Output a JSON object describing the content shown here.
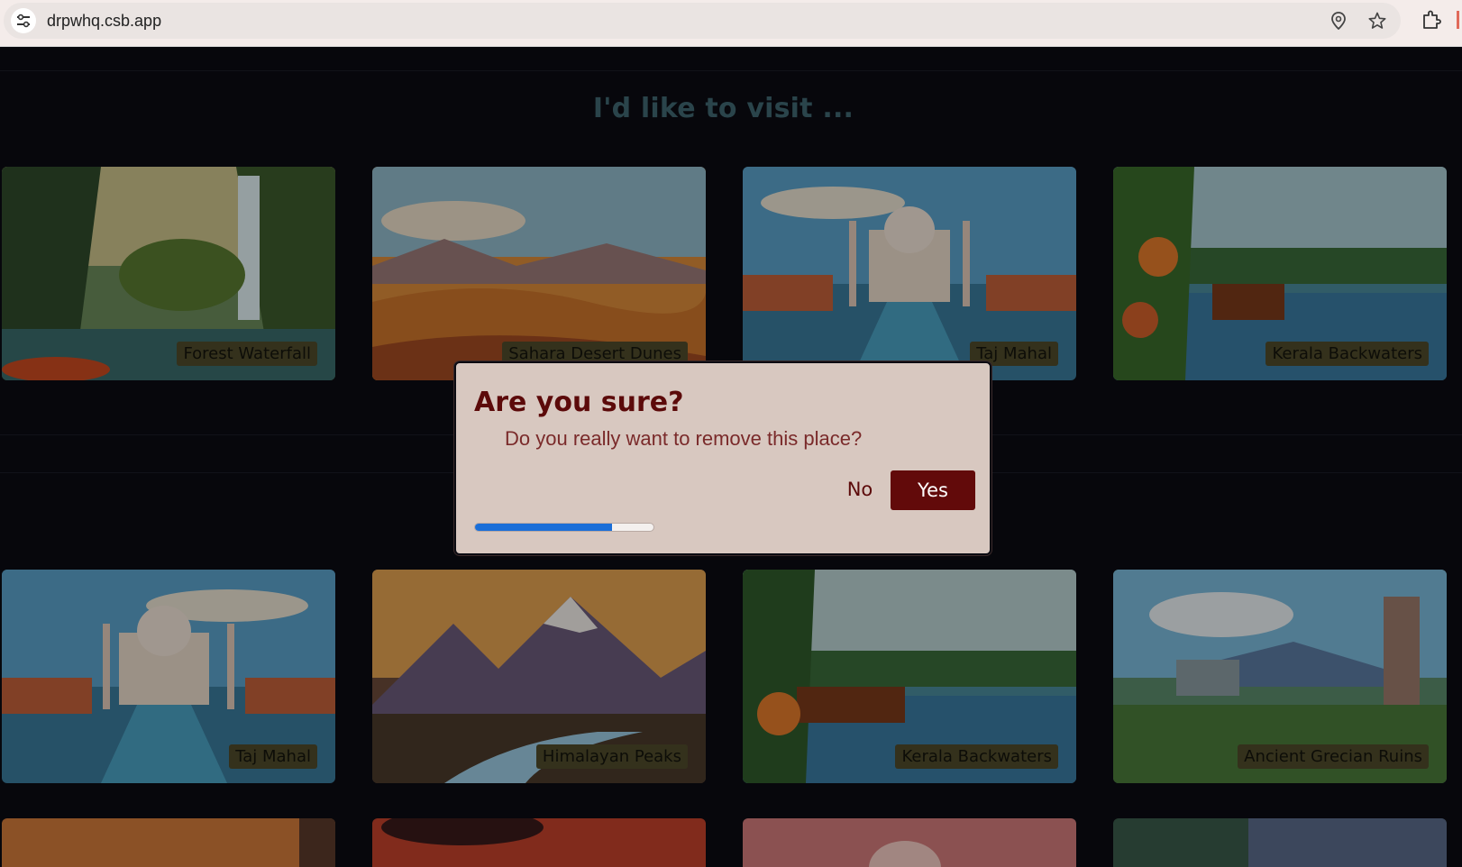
{
  "browser": {
    "url": "drpwhq.csb.app",
    "icons": [
      "site-settings-icon",
      "location-icon",
      "star-icon",
      "extensions-icon"
    ]
  },
  "page": {
    "title": "I'd like to visit ..."
  },
  "cards": [
    {
      "label": "Forest Waterfall"
    },
    {
      "label": "Sahara Desert Dunes"
    },
    {
      "label": "Taj Mahal"
    },
    {
      "label": "Kerala Backwaters"
    },
    {
      "label": "Taj Mahal"
    },
    {
      "label": "Himalayan Peaks"
    },
    {
      "label": "Kerala Backwaters"
    },
    {
      "label": "Ancient Grecian Ruins"
    }
  ],
  "dialog": {
    "title": "Are you sure?",
    "message": "Do you really want to remove this place?",
    "no_label": "No",
    "yes_label": "Yes",
    "progress": 0.77
  },
  "colors": {
    "accent_dark_red": "#620a0a",
    "dialog_bg": "#d8c8c0",
    "progress_blue": "#1a6ed8",
    "title_teal": "#3f6670"
  }
}
